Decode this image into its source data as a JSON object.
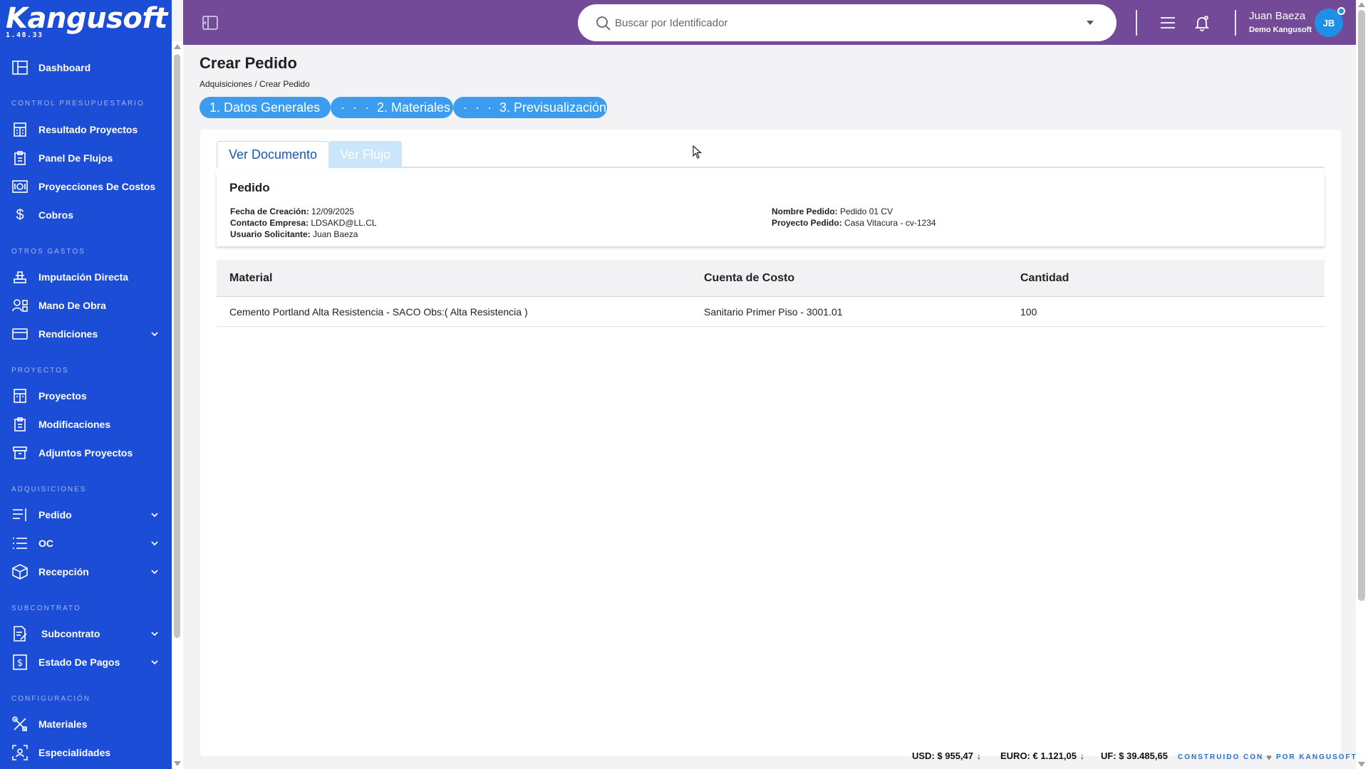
{
  "app": {
    "brand": "Kangusoft",
    "version": "1.48.33"
  },
  "sidebar": {
    "items": {
      "dashboard": "Dashboard",
      "resultado_proyectos": "Resultado Proyectos",
      "panel_flujos": "Panel De Flujos",
      "proyecciones_costos": "Proyecciones De Costos",
      "cobros": "Cobros",
      "imputacion_directa": "Imputación Directa",
      "mano_obra": "Mano De Obra",
      "rendiciones": "Rendiciones",
      "proyectos": "Proyectos",
      "modificaciones": "Modificaciones",
      "adjuntos_proyectos": "Adjuntos Proyectos",
      "pedido": "Pedido",
      "oc": "OC",
      "recepcion": "Recepción",
      "subcontrato": "Subcontrato",
      "estado_pagos": "Estado De Pagos",
      "materiales": "Materiales",
      "especialidades": "Especialidades"
    },
    "sections": {
      "control": "CONTROL PRESUPUESTARIO",
      "otros": "OTROS GASTOS",
      "proyectos": "PROYECTOS",
      "adquisiciones": "ADQUISICIONES",
      "subcontrato": "SUBCONTRATO",
      "configuracion": "CONFIGURACIÓN"
    }
  },
  "header": {
    "search_placeholder": "Buscar por Identificador",
    "user_name": "Juan Baeza",
    "user_org": "Demo Kangusoft",
    "avatar_initials": "JB"
  },
  "page": {
    "title": "Crear Pedido",
    "breadcrumb": "Adquisiciones / Crear Pedido",
    "steps": [
      {
        "label": "1. Datos Generales"
      },
      {
        "label": "2. Materiales"
      },
      {
        "label": "3. Previsualización"
      }
    ],
    "step_dots": "· · ·"
  },
  "tabs": {
    "ver_documento": "Ver Documento",
    "ver_flujo": "Ver Flujo"
  },
  "document": {
    "title": "Pedido",
    "fields": {
      "fecha_label": "Fecha de Creación:",
      "fecha_value": "12/09/2025",
      "contacto_label": "Contacto Empresa:",
      "contacto_value": "LDSAKD@LL.CL",
      "usuario_label": "Usuario Solicitante:",
      "usuario_value": "Juan Baeza",
      "nombre_label": "Nombre Pedido:",
      "nombre_value": "Pedido 01 CV",
      "proyecto_label": "Proyecto Pedido:",
      "proyecto_value": "Casa Vitacura - cv-1234"
    }
  },
  "table": {
    "headers": {
      "material": "Material",
      "cuenta": "Cuenta de Costo",
      "cantidad": "Cantidad"
    },
    "rows": [
      {
        "material": "Cemento Portland Alta Resistencia - SACO Obs:( Alta Resistencia )",
        "cuenta": "Sanitario Primer Piso - 3001.01",
        "cantidad": "100"
      }
    ]
  },
  "footer": {
    "usd": "USD: $ 955,47",
    "euro": "EURO: € 1.121,05",
    "uf": "UF: $ 39.485,65",
    "built_pre": "CONSTRUIDO CON",
    "built_post": "POR KANGUSOFT"
  },
  "colors": {
    "sidebar": "#1b4dd6",
    "header": "#724a97",
    "step": "#3b9cf0"
  }
}
